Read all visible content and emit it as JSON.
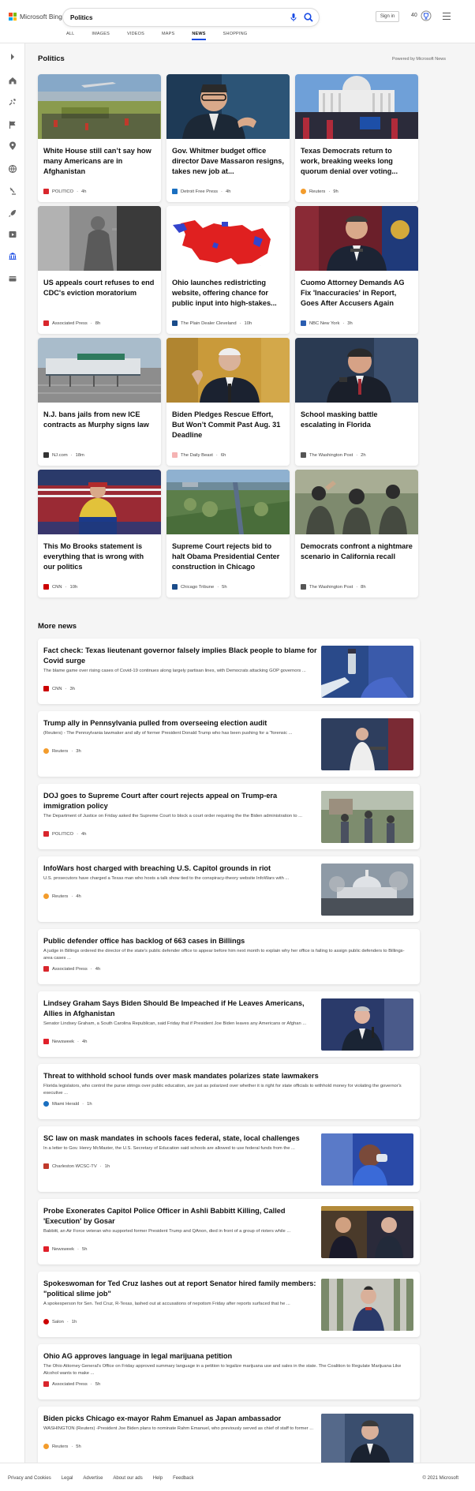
{
  "brand": "Microsoft Bing",
  "search": {
    "value": "Politics",
    "placeholder": ""
  },
  "header": {
    "signin": "Sign in",
    "points": "40"
  },
  "tabs": [
    "ALL",
    "IMAGES",
    "VIDEOS",
    "MAPS",
    "NEWS",
    "SHOPPING"
  ],
  "section": {
    "title": "Politics",
    "powered": "Powered by Microsoft News"
  },
  "cards": [
    {
      "title": "White House still can’t say how many Americans are in Afghanistan",
      "source": "POLITICO",
      "age": "4h",
      "logo_color": "#d9262c"
    },
    {
      "title": "Gov. Whitmer budget office director Dave Massaron resigns, takes new job at...",
      "source": "Detroit Free Press",
      "age": "4h",
      "logo_color": "#1a6fc0"
    },
    {
      "title": "Texas Democrats return to work, breaking weeks long quorum denial over voting...",
      "source": "Reuters",
      "age": "9h",
      "logo_color": "#f39c2c"
    },
    {
      "title": "US appeals court refuses to end CDC's eviction moratorium",
      "source": "Associated Press",
      "age": "8h",
      "logo_color": "#d9262c"
    },
    {
      "title": "Ohio launches redistricting website, offering chance for public input into high-stakes...",
      "source": "The Plain Dealer Cleveland",
      "age": "10h",
      "logo_color": "#1a4c8a"
    },
    {
      "title": "Cuomo Attorney Demands AG Fix 'Inaccuracies' in Report, Goes After Accusers Again",
      "source": "NBC New York",
      "age": "3h",
      "logo_color": "#2a5db0"
    },
    {
      "title": "N.J. bans jails from new ICE contracts as Murphy signs law",
      "source": "NJ.com",
      "age": "18m",
      "logo_color": "#333333"
    },
    {
      "title": "Biden Pledges Rescue Effort, But Won’t Commit Past Aug. 31 Deadline",
      "source": "The Daily Beast",
      "age": "6h",
      "logo_color": "#f5b3b3"
    },
    {
      "title": "School masking battle escalating in Florida",
      "source": "The Washington Post",
      "age": "2h",
      "logo_color": "#555555"
    },
    {
      "title": "This Mo Brooks statement is everything that is wrong with our politics",
      "source": "CNN",
      "age": "10h",
      "logo_color": "#cc0000"
    },
    {
      "title": "Supreme Court rejects bid to halt Obama Presidential Center construction in Chicago",
      "source": "Chicago Tribune",
      "age": "5h",
      "logo_color": "#1a4c8a"
    },
    {
      "title": "Democrats confront a nightmare scenario in California recall",
      "source": "The Washington Post",
      "age": "8h",
      "logo_color": "#555555"
    }
  ],
  "more_title": "More news",
  "news": [
    {
      "title": "Fact check: Texas lieutenant governor falsely implies Black people to blame for Covid surge",
      "desc": "The blame game over rising cases of Covid-19 continues along largely partisan lines, with Democrats attacking GOP governors ...",
      "source": "CNN",
      "age": "3h",
      "logo_color": "#cc0000"
    },
    {
      "title": "Trump ally in Pennsylvania pulled from overseeing election audit",
      "desc": "(Reuters) - The Pennsylvania lawmaker and ally of former President Donald Trump who has been pushing for a \"forensic ...",
      "source": "Reuters",
      "age": "3h",
      "logo_color": "#f39c2c"
    },
    {
      "title": "DOJ goes to Supreme Court after court rejects appeal on Trump-era immigration policy",
      "desc": "The Department of Justice on Friday asked the Supreme Court to block a court order requiring the the Biden administration to ...",
      "source": "POLITICO",
      "age": "4h",
      "logo_color": "#d9262c"
    },
    {
      "title": "InfoWars host charged with breaching U.S. Capitol grounds in riot",
      "desc": "U.S. prosecutors have charged a Texas man who hosts a talk show tied to the conspiracy-theory website InfoWars with ...",
      "source": "Reuters",
      "age": "4h",
      "logo_color": "#f39c2c"
    },
    {
      "title": "Public defender office has backlog of 663 cases in Billings",
      "desc": "A judge in Billings ordered the director of the state's public defender office to appear before him next month to explain why her office is failing to assign public defenders to Billings-area cases ...",
      "source": "Associated Press",
      "age": "4h",
      "logo_color": "#d9262c"
    },
    {
      "title": "Lindsey Graham Says Biden Should Be Impeached if He Leaves Americans, Allies in Afghanistan",
      "desc": "Senator Lindsey Graham, a South Carolina Republican, said Friday that if President Joe Biden leaves any Americans or Afghan ...",
      "source": "Newsweek",
      "age": "4h",
      "logo_color": "#e0202a"
    },
    {
      "title": "Threat to withhold school funds over mask mandates polarizes state lawmakers",
      "desc": "Florida legislators, who control the purse strings over public education, are just as polarized over whether it is right for state officials to withhold money for violating the governor's executive ...",
      "source": "Miami Herald",
      "age": "1h",
      "logo_color": "#1a6fc0"
    },
    {
      "title": "SC law on mask mandates in schools faces federal, state, local challenges",
      "desc": "In a letter to Gov. Henry McMaster, the U.S. Secretary of Education said schools are allowed to use federal funds from the ...",
      "source": "Charleston WCSC-TV",
      "age": "1h",
      "logo_color": "#c0392b"
    },
    {
      "title": "Probe Exonerates Capitol Police Officer in Ashli Babbitt Killing, Called 'Execution' by Gosar",
      "desc": "Babbitt, an Air Force veteran who supported former President Trump and QAnon, died in front of a group of rioters while ...",
      "source": "Newsweek",
      "age": "5h",
      "logo_color": "#e0202a"
    },
    {
      "title": "Spokeswoman for Ted Cruz lashes out at report Senator hired family members: \"political slime job\"",
      "desc": "A spokesperson for Sen. Ted Cruz, R-Texas, lashed out at accusations of nepotism Friday after reports surfaced that he ...",
      "source": "Salon",
      "age": "1h",
      "logo_color": "#cc0000"
    },
    {
      "title": "Ohio AG approves language in legal marijuana petition",
      "desc": "The Ohio Attorney General's Office on Friday approved summary language in a petition to legalize marijuana use and sales in the state. The Coalition to Regulate Marijuana Like Alcohol wants to make ...",
      "source": "Associated Press",
      "age": "5h",
      "logo_color": "#d9262c"
    },
    {
      "title": "Biden picks Chicago ex-mayor Rahm Emanuel as Japan ambassador",
      "desc": "WASHINGTON (Reuters) -President Joe Biden plans to nominate Rahm Emanuel, who previously served as chief of staff to former ...",
      "source": "Reuters",
      "age": "5h",
      "logo_color": "#f39c2c"
    }
  ],
  "footer": {
    "links": [
      "Privacy and Cookies",
      "Legal",
      "Advertise",
      "About our ads",
      "Help",
      "Feedback"
    ],
    "copyright": "© 2021 Microsoft"
  },
  "icons": [
    "expand-icon",
    "home-icon",
    "sports-icon",
    "flag-icon",
    "location-icon",
    "globe-icon",
    "science-icon",
    "rocket-icon",
    "entertainment-icon",
    "politics-icon",
    "finance-icon"
  ]
}
